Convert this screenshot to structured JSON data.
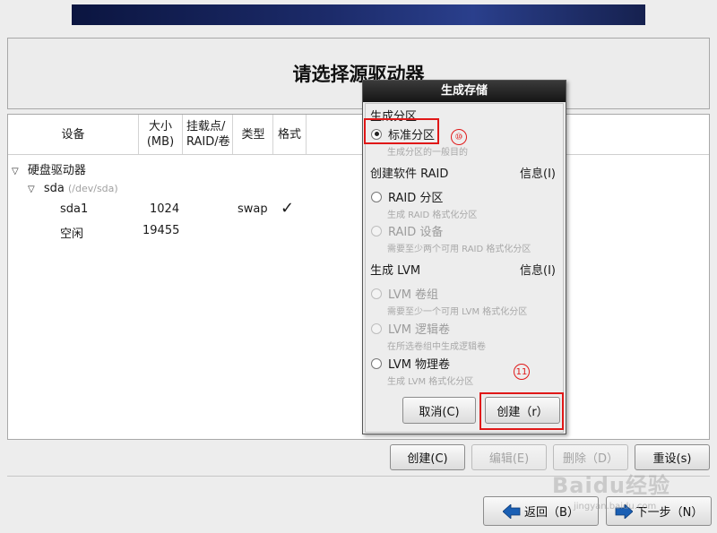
{
  "page": {
    "title": "请选择源驱动器"
  },
  "table": {
    "columns": [
      "设备",
      "大小\n(MB)",
      "挂载点/\nRAID/卷",
      "类型",
      "格式"
    ],
    "tree": {
      "group_label": "硬盘驱动器",
      "disk_label": "sda",
      "disk_path": "(/dev/sda)",
      "rows": [
        {
          "device": "sda1",
          "size": "1024",
          "mount": "",
          "type": "swap",
          "format": "✓"
        },
        {
          "device": "空闲",
          "size": "19455",
          "mount": "",
          "type": "",
          "format": ""
        }
      ]
    }
  },
  "dialog": {
    "title": "生成存储",
    "section_partition": "生成分区",
    "opt_standard": "标准分区",
    "hint_standard": "生成分区的一般目的",
    "section_raid": "创建软件 RAID",
    "info_label": "信息(I)",
    "opt_raid_partition": "RAID 分区",
    "hint_raid_partition": "生成 RAID 格式化分区",
    "opt_raid_device": "RAID 设备",
    "hint_raid_device": "需要至少两个可用 RAID 格式化分区",
    "section_lvm": "生成 LVM",
    "opt_lvm_vg": "LVM 卷组",
    "hint_lvm_vg": "需要至少一个可用 LVM 格式化分区",
    "opt_lvm_lv": "LVM 逻辑卷",
    "hint_lvm_lv": "在所选卷组中生成逻辑卷",
    "opt_lvm_pv": "LVM 物理卷",
    "hint_lvm_pv": "生成 LVM 格式化分区",
    "cancel": "取消(C)",
    "create": "创建（r）"
  },
  "annotations": {
    "step10": "⑩",
    "step11": "11"
  },
  "toolbar": {
    "create": "创建(C)",
    "edit": "编辑(E)",
    "delete": "删除（D）",
    "reset": "重设(s)"
  },
  "nav": {
    "back": "返回（B）",
    "next": "下一步（N）"
  },
  "watermark": {
    "text": "Baidu经验",
    "url": "jingyan.baidu.com"
  },
  "colors": {
    "highlight": "#e01818",
    "banner": "#1c2b6a",
    "arrow": "#1a5fb4"
  }
}
